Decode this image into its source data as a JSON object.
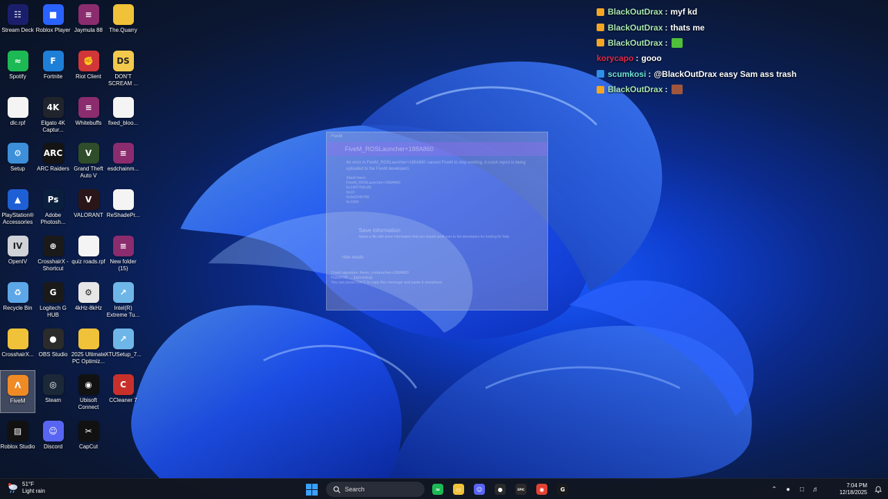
{
  "desktop": {
    "icons": [
      {
        "label": "Stream Deck",
        "icon": "stream-deck-icon",
        "color": "#1b1f6b",
        "glyph": "☷"
      },
      {
        "label": "Roblox Player",
        "icon": "roblox-icon",
        "color": "#2a62ff",
        "glyph": "■"
      },
      {
        "label": "Jaymula 88",
        "icon": "winrar-archive-icon",
        "color": "#8b2c6e",
        "glyph": "≡"
      },
      {
        "label": "The.Quarry",
        "icon": "folder-icon",
        "color": "#f0c23a",
        "glyph": ""
      },
      {
        "label": "Spotify",
        "icon": "spotify-icon",
        "color": "#1db954",
        "glyph": "≈"
      },
      {
        "label": "Fortnite",
        "icon": "fortnite-icon",
        "color": "#1e7fd8",
        "glyph": "F"
      },
      {
        "label": "Riot Client",
        "icon": "riot-client-icon",
        "color": "#d13639",
        "glyph": "✊"
      },
      {
        "label": "DON'T SCREAM ...",
        "icon": "dont-scream-icon",
        "color": "#f2c94c",
        "glyph": "DS"
      },
      {
        "label": "dlc.rpf",
        "icon": "file-icon",
        "color": "#f4f4f4",
        "glyph": ""
      },
      {
        "label": "Elgato 4K Captur...",
        "icon": "elgato-4k-icon",
        "color": "#20242c",
        "glyph": "4K"
      },
      {
        "label": "Whitebuffs",
        "icon": "winrar-archive-icon",
        "color": "#8b2c6e",
        "glyph": "≡"
      },
      {
        "label": "fixed_bloo...",
        "icon": "file-icon",
        "color": "#f4f4f4",
        "glyph": ""
      },
      {
        "label": "Setup",
        "icon": "setup-icon",
        "color": "#3c8fd8",
        "glyph": "⚙"
      },
      {
        "label": "ARC Raiders",
        "icon": "arc-raiders-icon",
        "color": "#141414",
        "glyph": "ARC"
      },
      {
        "label": "Grand Theft Auto V",
        "icon": "gta-v-icon",
        "color": "#2f4d2a",
        "glyph": "V"
      },
      {
        "label": "esdchainm...",
        "icon": "winrar-archive-icon",
        "color": "#8b2c6e",
        "glyph": "≡"
      },
      {
        "label": "PlayStation® Accessories",
        "icon": "playstation-icon",
        "color": "#1f5fd6",
        "glyph": "▲"
      },
      {
        "label": "Adobe Photosh...",
        "icon": "photoshop-icon",
        "color": "#0a1f3d",
        "glyph": "Ps"
      },
      {
        "label": "VALORANT",
        "icon": "valorant-icon",
        "color": "#2a1618",
        "glyph": "V"
      },
      {
        "label": "ReShadePr...",
        "icon": "file-icon",
        "color": "#f4f4f4",
        "glyph": ""
      },
      {
        "label": "OpenIV",
        "icon": "openiv-icon",
        "color": "#cfd3d8",
        "glyph": "IV"
      },
      {
        "label": "CrosshairX - Shortcut",
        "icon": "crosshair-icon",
        "color": "#1a1a1a",
        "glyph": "⊕"
      },
      {
        "label": "quiz roads.rpf",
        "icon": "file-icon",
        "color": "#f4f4f4",
        "glyph": ""
      },
      {
        "label": "New folder (15)",
        "icon": "winrar-archive-icon",
        "color": "#8b2c6e",
        "glyph": "≡"
      },
      {
        "label": "Recycle Bin",
        "icon": "recycle-bin-icon",
        "color": "#5da7e8",
        "glyph": "♻"
      },
      {
        "label": "Logitech G HUB",
        "icon": "logitech-icon",
        "color": "#1a1a1a",
        "glyph": "G"
      },
      {
        "label": "4kHz-8kHz",
        "icon": "settings-file-icon",
        "color": "#e6e6e6",
        "glyph": "⚙"
      },
      {
        "label": "Intel(R) Extreme Tu...",
        "icon": "intel-xtu-icon",
        "color": "#6fb6e8",
        "glyph": "↗"
      },
      {
        "label": "CrosshairX...",
        "icon": "folder-icon",
        "color": "#f0c23a",
        "glyph": ""
      },
      {
        "label": "OBS Studio",
        "icon": "obs-icon",
        "color": "#2b2b2b",
        "glyph": "●"
      },
      {
        "label": "2025 Ultimate PC Optimiz...",
        "icon": "folder-icon",
        "color": "#f0c23a",
        "glyph": ""
      },
      {
        "label": "XTUSetup_7...",
        "icon": "intel-xtu-icon",
        "color": "#6fb6e8",
        "glyph": "↗"
      },
      {
        "label": "FiveM",
        "icon": "fivem-icon",
        "color": "#f08a24",
        "glyph": "Λ"
      },
      {
        "label": "Steam",
        "icon": "steam-icon",
        "color": "#1b2838",
        "glyph": "◎"
      },
      {
        "label": "Ubisoft Connect",
        "icon": "ubisoft-icon",
        "color": "#111111",
        "glyph": "◉"
      },
      {
        "label": "CCleaner 7",
        "icon": "ccleaner-icon",
        "color": "#c8312b",
        "glyph": "C"
      },
      {
        "label": "Roblox Studio",
        "icon": "roblox-studio-icon",
        "color": "#111111",
        "glyph": "▨"
      },
      {
        "label": "Discord",
        "icon": "discord-icon",
        "color": "#5865f2",
        "glyph": "☺"
      },
      {
        "label": "CapCut",
        "icon": "capcut-icon",
        "color": "#111111",
        "glyph": "✂"
      }
    ],
    "selected_icon": "FiveM"
  },
  "chat": {
    "messages": [
      {
        "user": "BlackOutDrax",
        "user_color": "#a8e6b0",
        "badge_color": "#f5a623",
        "text": "myf kd",
        "emote": null
      },
      {
        "user": "BlackOutDrax",
        "user_color": "#a8e6b0",
        "badge_color": "#f5a623",
        "text": "thats me",
        "emote": null
      },
      {
        "user": "BlackOutDrax",
        "user_color": "#a8e6b0",
        "badge_color": "#f5a623",
        "text": "",
        "emote": "#4fbf3a"
      },
      {
        "user": "korycapo",
        "user_color": "#e0294a",
        "badge_color": null,
        "text": "gooo",
        "emote": null
      },
      {
        "user": "scumkosi",
        "user_color": "#6fe3d6",
        "badge_color": "#2f8fe6",
        "text": "@BlackOutDrax easy Sam ass trash",
        "emote": null
      },
      {
        "user": "BlackOutDrax",
        "user_color": "#a8e6b0",
        "badge_color": "#f5a623",
        "text": "",
        "emote": "#a0563c"
      }
    ],
    "separator": ":"
  },
  "crash_dialog": {
    "window_title": "FiveM",
    "banner_title": "FiveM_ROSLauncher+188A860",
    "message": "An error in FiveM_ROSLauncher+188A860 caused FiveM to stop working. A crash report is being uploaded to the FiveM developers.",
    "stack_label": "Stack trace:",
    "stack_lines": [
      "FiveM_ROSLauncher+188A860",
      "0x14077b5c00",
      "0x10",
      "0x9e5246780",
      "0x1000"
    ],
    "save_title": "Save information",
    "save_description": "Saves a file with some information that you should send over to the developers for looking for help.",
    "hide_label": "Hide details",
    "signature": "Crash signature: fivem_roslauncher+188A860",
    "report_id": "Report ID: ... [uploading]",
    "copy_hint": "You can press Ctrl-C to copy this message and paste it elsewhere."
  },
  "taskbar": {
    "weather_temp": "51°F",
    "weather_desc": "Light rain",
    "search_placeholder": "Search",
    "apps": [
      {
        "name": "spotify-taskbar-icon",
        "color": "#1db954",
        "glyph": "≈"
      },
      {
        "name": "file-explorer-taskbar-icon",
        "color": "#f0c23a",
        "glyph": "▭"
      },
      {
        "name": "discord-taskbar-icon",
        "color": "#5865f2",
        "glyph": "☺"
      },
      {
        "name": "obs-taskbar-icon",
        "color": "#2b2b2b",
        "glyph": "●"
      },
      {
        "name": "epic-games-taskbar-icon",
        "color": "#2a2a2a",
        "glyph": "EPIC"
      },
      {
        "name": "chrome-taskbar-icon",
        "color": "#e34133",
        "glyph": "◉"
      },
      {
        "name": "logitech-taskbar-icon",
        "color": "#1a1a1a",
        "glyph": "G"
      }
    ],
    "time": "7:04 PM",
    "date": "12/18/2025"
  }
}
